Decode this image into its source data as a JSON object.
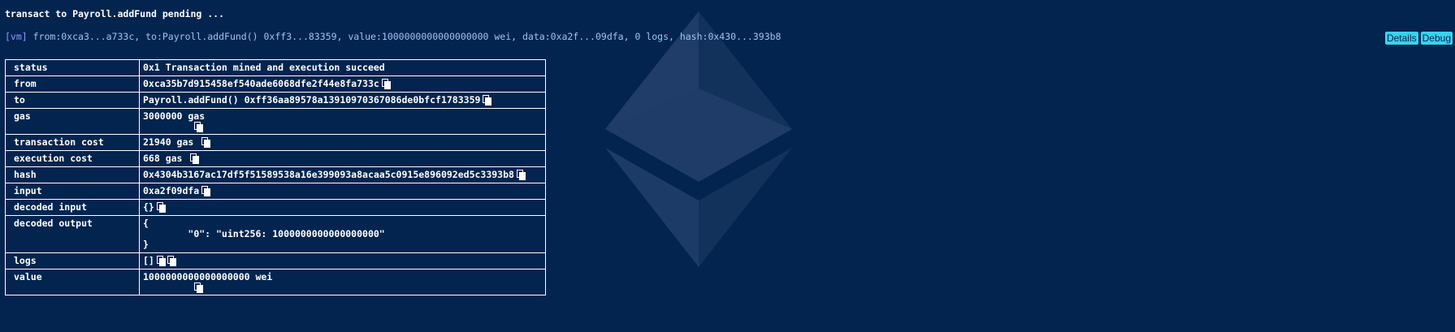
{
  "pending": "transact to Payroll.addFund pending ...",
  "log": {
    "tag": "[vm]",
    "text": " from:0xca3...a733c, to:Payroll.addFund() 0xff3...83359, value:1000000000000000000 wei, data:0xa2f...09dfa, 0 logs, hash:0x430...393b8"
  },
  "buttons": {
    "details": "Details",
    "debug": "Debug"
  },
  "rows": {
    "status": {
      "key": "status",
      "value": "0x1 Transaction mined and execution succeed"
    },
    "from": {
      "key": "from",
      "value": "0xca35b7d915458ef540ade6068dfe2f44e8fa733c"
    },
    "to": {
      "key": "to",
      "value": "Payroll.addFund() 0xff36aa89578a13910970367086de0bfcf1783359"
    },
    "gas": {
      "key": "gas",
      "value": "3000000 gas"
    },
    "transaction_cost": {
      "key": "transaction cost",
      "value": "21940 gas"
    },
    "execution_cost": {
      "key": "execution cost",
      "value": "668 gas"
    },
    "hash": {
      "key": "hash",
      "value": "0x4304b3167ac17df5f51589538a16e399093a8acaa5c0915e896092ed5c3393b8"
    },
    "input": {
      "key": "input",
      "value": "0xa2f09dfa"
    },
    "decoded_input": {
      "key": "decoded input",
      "value": "{}"
    },
    "decoded_output": {
      "key": "decoded output",
      "line1": "{",
      "line2": "\t\"0\": \"uint256: 1000000000000000000\"",
      "line3": "}"
    },
    "logs": {
      "key": "logs",
      "value": "[]"
    },
    "value": {
      "key": "value",
      "value": "1000000000000000000 wei"
    }
  },
  "icons": {
    "copy": "copy-icon",
    "logo": "ethereum-logo"
  }
}
